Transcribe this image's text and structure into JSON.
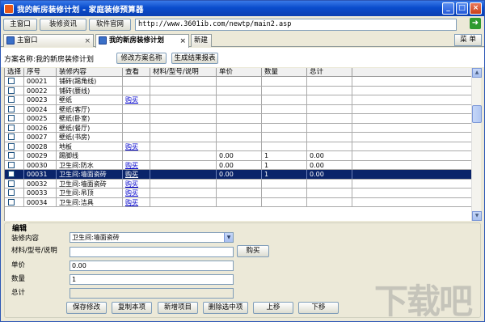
{
  "titlebar": {
    "title": "我的新房装修计划 - 家庭装修预算器",
    "minimize": "_",
    "maximize": "□",
    "close": "×"
  },
  "toolbar": {
    "buttons": [
      "主窗口",
      "装修资讯",
      "软件官网"
    ],
    "url": "http://www.3601ib.com/newtp/main2.asp",
    "go": "➜"
  },
  "tabs": [
    {
      "label": "主窗口",
      "close": "×"
    },
    {
      "label": "我的新房装修计划",
      "close": "×"
    },
    {
      "label": "新建"
    }
  ],
  "menu_button": "菜 单",
  "plan": {
    "label": "方案名称:我的新房装修计划",
    "rename_button": "修改方案名称",
    "report_button": "生成结果报表"
  },
  "grid": {
    "columns": [
      "选择",
      "序号",
      "装修内容",
      "查看",
      "材料/型号/说明",
      "单价",
      "数量",
      "总计"
    ],
    "rows": [
      {
        "no": "00021",
        "content": "铺砖(踢角线)",
        "view": "",
        "material": "",
        "price": "",
        "qty": "",
        "total": ""
      },
      {
        "no": "00022",
        "content": "铺砖(腰线)",
        "view": "",
        "material": "",
        "price": "",
        "qty": "",
        "total": ""
      },
      {
        "no": "00023",
        "content": "壁纸",
        "view": "购买",
        "material": "",
        "price": "",
        "qty": "",
        "total": ""
      },
      {
        "no": "00024",
        "content": "壁纸(客厅)",
        "view": "",
        "material": "",
        "price": "",
        "qty": "",
        "total": ""
      },
      {
        "no": "00025",
        "content": "壁纸(卧室)",
        "view": "",
        "material": "",
        "price": "",
        "qty": "",
        "total": ""
      },
      {
        "no": "00026",
        "content": "壁纸(餐厅)",
        "view": "",
        "material": "",
        "price": "",
        "qty": "",
        "total": ""
      },
      {
        "no": "00027",
        "content": "壁纸(书房)",
        "view": "",
        "material": "",
        "price": "",
        "qty": "",
        "total": ""
      },
      {
        "no": "00028",
        "content": "地板",
        "view": "购买",
        "material": "",
        "price": "",
        "qty": "",
        "total": ""
      },
      {
        "no": "00029",
        "content": "踢脚线",
        "view": "",
        "material": "",
        "price": "0.00",
        "qty": "1",
        "total": "0.00"
      },
      {
        "no": "00030",
        "content": "卫生间:防水",
        "view": "购买",
        "material": "",
        "price": "0.00",
        "qty": "1",
        "total": "0.00"
      },
      {
        "no": "00031",
        "content": "卫生间:墙面瓷砖",
        "view": "购买",
        "material": "",
        "price": "0.00",
        "qty": "1",
        "total": "0.00",
        "selected": true
      },
      {
        "no": "00032",
        "content": "卫生间:墙面瓷砖",
        "view": "购买",
        "material": "",
        "price": "",
        "qty": "",
        "total": ""
      },
      {
        "no": "00033",
        "content": "卫生间:吊顶",
        "view": "购买",
        "material": "",
        "price": "",
        "qty": "",
        "total": ""
      },
      {
        "no": "00034",
        "content": "卫生间:洁具",
        "view": "购买",
        "material": "",
        "price": "",
        "qty": "",
        "total": ""
      }
    ]
  },
  "edit": {
    "legend": "编辑",
    "content_label": "装修内容",
    "content_value": "卫生间:墙面瓷砖",
    "material_label": "材料/型号/说明",
    "material_value": "",
    "buy_button": "购买",
    "price_label": "单价",
    "price_value": "0.00",
    "qty_label": "数量",
    "qty_value": "1",
    "total_label": "总计",
    "total_value": "",
    "buttons": [
      "保存修改",
      "复制本项",
      "新增项目",
      "删除选中项",
      "上移",
      "下移"
    ]
  },
  "watermark": "下载吧"
}
